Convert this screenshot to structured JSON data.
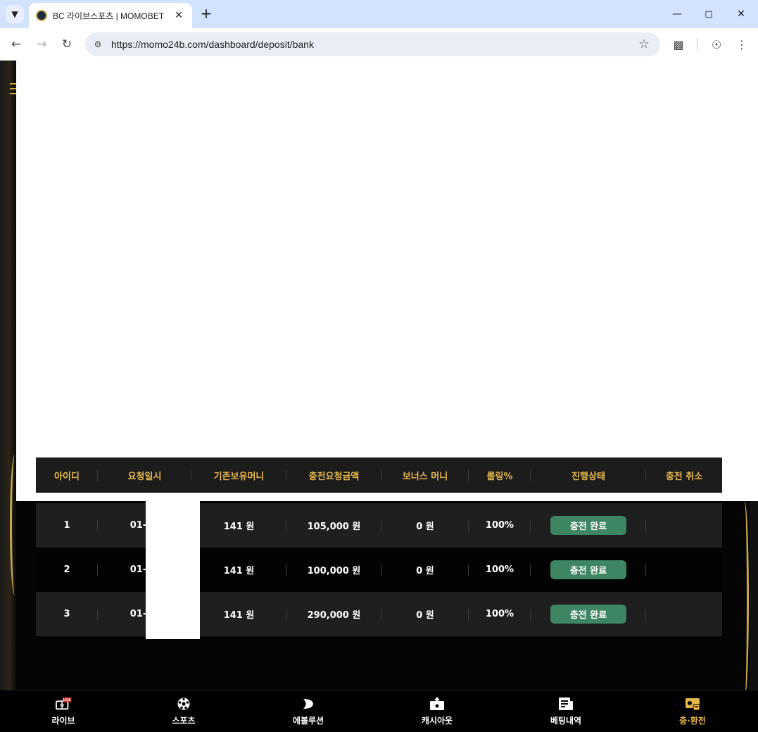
{
  "browser": {
    "tab_title": "BC 라이브스포츠 | MOMOBET",
    "url": "https://momo24b.com/dashboard/deposit/bank"
  },
  "table": {
    "headers": [
      "아이디",
      "요청일시",
      "기존보유머니",
      "충전요청금액",
      "보너스 머니",
      "롤링%",
      "진행상태",
      "충전 취소"
    ],
    "rows": [
      {
        "id": "1",
        "date": "01-15",
        "balance": "141 원",
        "amount": "105,000 원",
        "bonus": "0 원",
        "rolling": "100%",
        "status": "충전 완료",
        "cancel": ""
      },
      {
        "id": "2",
        "date": "01-15",
        "balance": "141 원",
        "amount": "100,000 원",
        "bonus": "0 원",
        "rolling": "100%",
        "status": "충전 완료",
        "cancel": ""
      },
      {
        "id": "3",
        "date": "01-15",
        "balance": "141 원",
        "amount": "290,000 원",
        "bonus": "0 원",
        "rolling": "100%",
        "status": "충전 완료",
        "cancel": ""
      }
    ]
  },
  "bottom_nav": {
    "items": [
      {
        "label": "라이브",
        "icon": "live-icon"
      },
      {
        "label": "스포츠",
        "icon": "soccer-ball-icon"
      },
      {
        "label": "에볼루션",
        "icon": "evolution-icon"
      },
      {
        "label": "캐시아웃",
        "icon": "cashout-icon"
      },
      {
        "label": "베팅내역",
        "icon": "betting-history-icon"
      },
      {
        "label": "충·환전",
        "icon": "deposit-withdraw-icon"
      }
    ],
    "live_badge": "LIVE",
    "active_index": 5
  },
  "colors": {
    "accent_gold": "#e6b84a",
    "status_green": "#3e8563",
    "browser_tabbar": "#d3e3fd"
  }
}
